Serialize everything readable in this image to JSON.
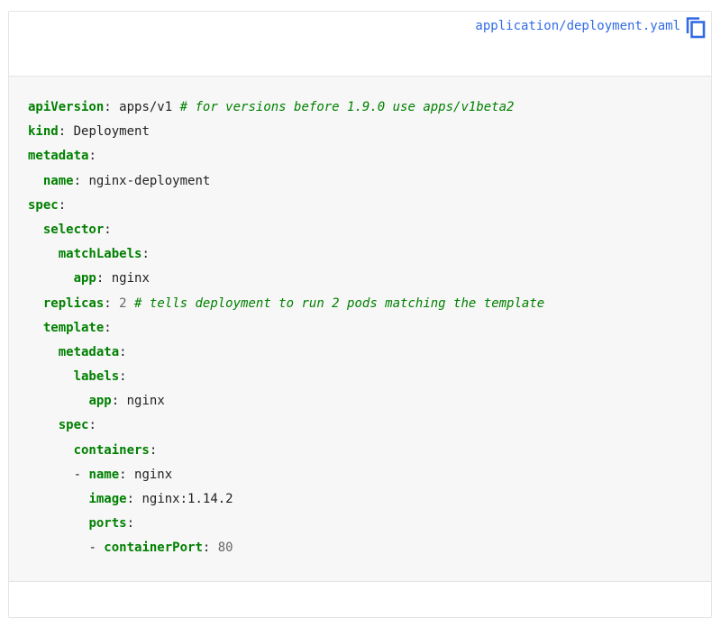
{
  "header": {
    "filename": "application/deployment.yaml",
    "copy_icon": "copy-icon"
  },
  "colors": {
    "link": "#326ce5",
    "key": "#008000",
    "comment": "#008000",
    "number": "#666666",
    "code_bg": "#f7f7f7",
    "border": "#e4e4e4"
  },
  "code": {
    "lines": [
      {
        "indent": "",
        "dash": "",
        "key": "apiVersion",
        "sep": ":",
        "value": " apps/v1",
        "number": "",
        "comment": " # for versions before 1.9.0 use apps/v1beta2"
      },
      {
        "indent": "",
        "dash": "",
        "key": "kind",
        "sep": ":",
        "value": " Deployment",
        "number": "",
        "comment": ""
      },
      {
        "indent": "",
        "dash": "",
        "key": "metadata",
        "sep": ":",
        "value": "",
        "number": "",
        "comment": ""
      },
      {
        "indent": "  ",
        "dash": "",
        "key": "name",
        "sep": ":",
        "value": " nginx-deployment",
        "number": "",
        "comment": ""
      },
      {
        "indent": "",
        "dash": "",
        "key": "spec",
        "sep": ":",
        "value": "",
        "number": "",
        "comment": ""
      },
      {
        "indent": "  ",
        "dash": "",
        "key": "selector",
        "sep": ":",
        "value": "",
        "number": "",
        "comment": ""
      },
      {
        "indent": "    ",
        "dash": "",
        "key": "matchLabels",
        "sep": ":",
        "value": "",
        "number": "",
        "comment": ""
      },
      {
        "indent": "      ",
        "dash": "",
        "key": "app",
        "sep": ":",
        "value": " nginx",
        "number": "",
        "comment": ""
      },
      {
        "indent": "  ",
        "dash": "",
        "key": "replicas",
        "sep": ":",
        "value": " ",
        "number": "2",
        "comment": " # tells deployment to run 2 pods matching the template"
      },
      {
        "indent": "  ",
        "dash": "",
        "key": "template",
        "sep": ":",
        "value": "",
        "number": "",
        "comment": ""
      },
      {
        "indent": "    ",
        "dash": "",
        "key": "metadata",
        "sep": ":",
        "value": "",
        "number": "",
        "comment": ""
      },
      {
        "indent": "      ",
        "dash": "",
        "key": "labels",
        "sep": ":",
        "value": "",
        "number": "",
        "comment": ""
      },
      {
        "indent": "        ",
        "dash": "",
        "key": "app",
        "sep": ":",
        "value": " nginx",
        "number": "",
        "comment": ""
      },
      {
        "indent": "    ",
        "dash": "",
        "key": "spec",
        "sep": ":",
        "value": "",
        "number": "",
        "comment": ""
      },
      {
        "indent": "      ",
        "dash": "",
        "key": "containers",
        "sep": ":",
        "value": "",
        "number": "",
        "comment": ""
      },
      {
        "indent": "      ",
        "dash": "- ",
        "key": "name",
        "sep": ":",
        "value": " nginx",
        "number": "",
        "comment": ""
      },
      {
        "indent": "        ",
        "dash": "",
        "key": "image",
        "sep": ":",
        "value": " nginx:1.14.2",
        "number": "",
        "comment": ""
      },
      {
        "indent": "        ",
        "dash": "",
        "key": "ports",
        "sep": ":",
        "value": "",
        "number": "",
        "comment": ""
      },
      {
        "indent": "        ",
        "dash": "- ",
        "key": "containerPort",
        "sep": ":",
        "value": " ",
        "number": "80",
        "comment": ""
      }
    ]
  }
}
